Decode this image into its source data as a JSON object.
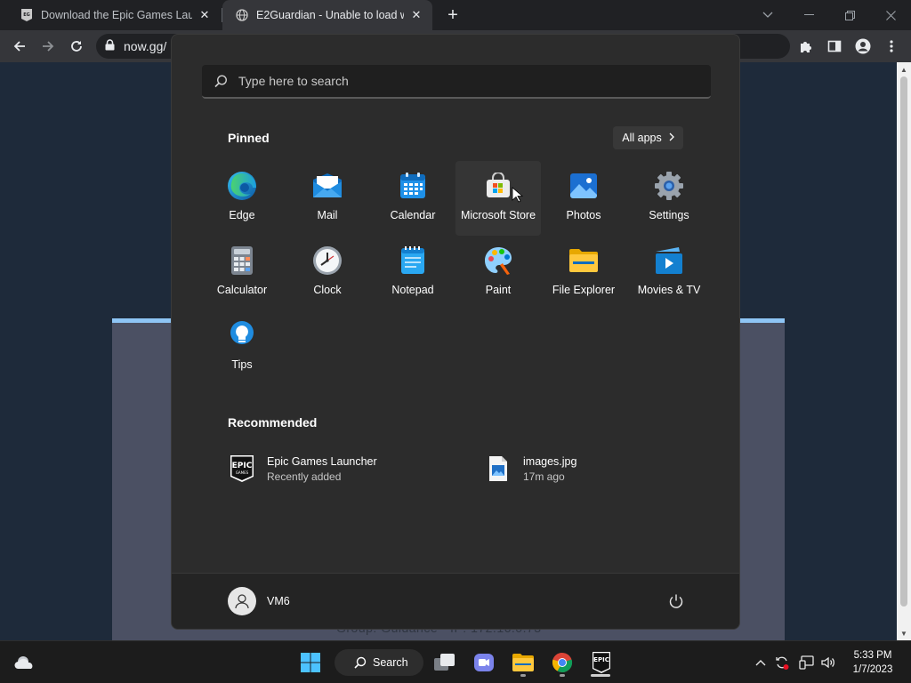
{
  "browser": {
    "tabs": [
      {
        "title": "Download the Epic Games Launcher",
        "active": false
      },
      {
        "title": "E2Guardian - Unable to load web page",
        "active": true
      }
    ],
    "url": "now.gg/"
  },
  "webpage": {
    "footer_text": "Group: Guidance - IP: 172.16.0.73"
  },
  "start_menu": {
    "search_placeholder": "Type here to search",
    "pinned_title": "Pinned",
    "all_apps_label": "All apps",
    "pinned": [
      {
        "label": "Edge",
        "icon": "edge-icon"
      },
      {
        "label": "Mail",
        "icon": "mail-icon"
      },
      {
        "label": "Calendar",
        "icon": "calendar-icon"
      },
      {
        "label": "Microsoft Store",
        "icon": "store-icon"
      },
      {
        "label": "Photos",
        "icon": "photos-icon"
      },
      {
        "label": "Settings",
        "icon": "settings-icon"
      },
      {
        "label": "Calculator",
        "icon": "calculator-icon"
      },
      {
        "label": "Clock",
        "icon": "clock-icon"
      },
      {
        "label": "Notepad",
        "icon": "notepad-icon"
      },
      {
        "label": "Paint",
        "icon": "paint-icon"
      },
      {
        "label": "File Explorer",
        "icon": "folder-icon"
      },
      {
        "label": "Movies & TV",
        "icon": "movies-icon"
      },
      {
        "label": "Tips",
        "icon": "tips-icon"
      }
    ],
    "recommended_title": "Recommended",
    "recommended": [
      {
        "name": "Epic Games Launcher",
        "sub": "Recently added",
        "icon": "epic-icon"
      },
      {
        "name": "images.jpg",
        "sub": "17m ago",
        "icon": "image-file-icon"
      }
    ],
    "user": "VM6"
  },
  "taskbar": {
    "search_label": "Search",
    "time": "5:33 PM",
    "date": "1/7/2023",
    "epic_text": "EPIC"
  },
  "colors": {
    "accent": "#0078d4",
    "start_bg": "#2c2c2c",
    "taskbar_bg": "#1c1c1c"
  }
}
